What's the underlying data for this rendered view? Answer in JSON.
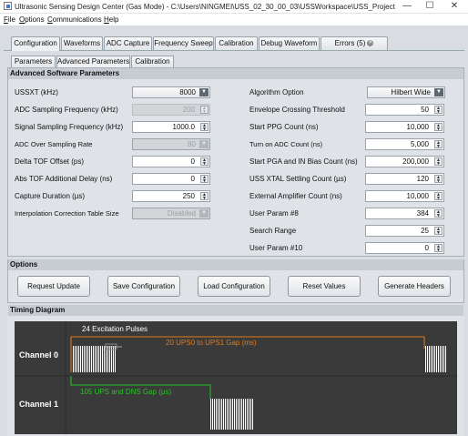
{
  "window": {
    "title": "Ultrasonic Sensing Design Center (Gas Mode) - C:\\Users\\NINGMEI\\USS_02_30_00_03\\USSWorkspace\\USS_Project",
    "minimize": "—",
    "maximize": "☐",
    "close": "✕"
  },
  "menu": [
    {
      "label": "File",
      "key": "F"
    },
    {
      "label": "Options",
      "key": "O"
    },
    {
      "label": "Communications",
      "key": "C"
    },
    {
      "label": "Help",
      "key": "H"
    }
  ],
  "tabs": [
    "Configuration",
    "Waveforms",
    "ADC Capture",
    "Frequency Sweep",
    "Calibration",
    "Debug Waveform",
    "Errors (5)"
  ],
  "subtabs": [
    "Parameters",
    "Advanced Parameters",
    "Calibration"
  ],
  "adv": {
    "header": "Advanced Software Parameters",
    "left": [
      {
        "label": "USSXT (kHz)",
        "value": "8000",
        "type": "combo",
        "enabled": true
      },
      {
        "label": "ADC Sampling Frequency (kHz)",
        "value": "200",
        "type": "spin",
        "enabled": false
      },
      {
        "label": "Signal Sampling Frequency (kHz)",
        "value": "1000.0",
        "type": "spin",
        "enabled": true
      },
      {
        "label": "ADC Over Sampling Rate",
        "value": "80",
        "type": "combo",
        "enabled": false
      },
      {
        "label": "Delta TOF Offset (ps)",
        "value": "0",
        "type": "spin",
        "enabled": true
      },
      {
        "label": "Abs TOF Additional Delay (ns)",
        "value": "0",
        "type": "spin",
        "enabled": true
      },
      {
        "label": "Capture Duration (µs)",
        "value": "250",
        "type": "spin",
        "enabled": true
      },
      {
        "label": "Interpolation Correction Table Size",
        "value": "Disabled",
        "type": "combo",
        "enabled": false
      }
    ],
    "right": [
      {
        "label": "Algorithm Option",
        "value": "Hilbert Wide",
        "type": "combo"
      },
      {
        "label": "Envelope Crossing Threshold",
        "value": "50",
        "type": "spin"
      },
      {
        "label": "Start PPG Count (ns)",
        "value": "10,000",
        "type": "spin"
      },
      {
        "label": "Turn on ADC Count (ns)",
        "value": "5,000",
        "type": "spin"
      },
      {
        "label": "Start PGA and IN Bias Count (ns)",
        "value": "200,000",
        "type": "spin"
      },
      {
        "label": "USS XTAL Settling Count (µs)",
        "value": "120",
        "type": "spin"
      },
      {
        "label": "External Amplifier Count (ns)",
        "value": "10,000",
        "type": "spin"
      },
      {
        "label": "User Param #8",
        "value": "384",
        "type": "spin"
      },
      {
        "label": "Search Range",
        "value": "25",
        "type": "spin"
      },
      {
        "label": "User Param #10",
        "value": "0",
        "type": "spin"
      }
    ]
  },
  "options": {
    "header": "Options",
    "buttons": [
      "Request Update",
      "Save Configuration",
      "Load Configuration",
      "Reset Values",
      "Generate Headers"
    ]
  },
  "timing": {
    "header": "Timing Diagram",
    "ch0": "Channel 0",
    "ch1": "Channel 1",
    "pulses": "24 Excitation Pulses",
    "gap0": "20 UPS0 to UPS1 Gap (ms)",
    "gap1": "105 UPS and DNS Gap (µs)",
    "colors": {
      "bg": "#3a3a3a",
      "gap0": "#e07b1a",
      "gap1": "#27c227",
      "pulse": "#ffffff"
    }
  }
}
